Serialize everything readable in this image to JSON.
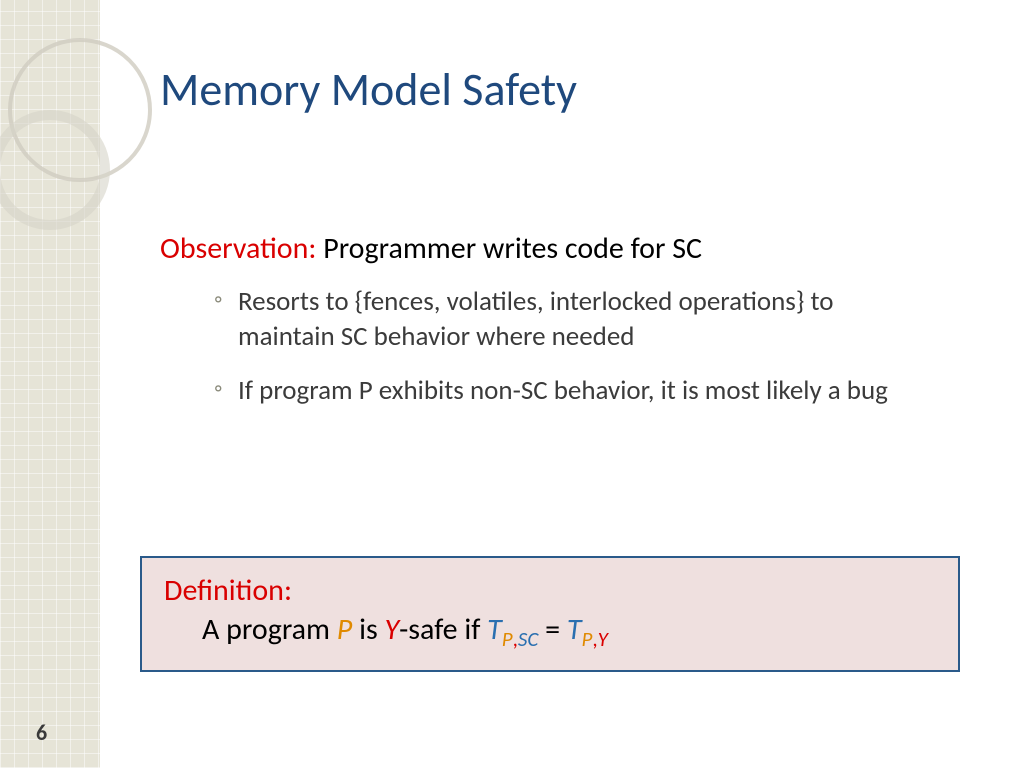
{
  "title": "Memory Model Safety",
  "observation": {
    "label": "Observation:",
    "text": "Programmer writes code for SC"
  },
  "bullets": [
    "Resorts to {fences, volatiles, interlocked operations} to maintain SC behavior where needed",
    "If program P exhibits non-SC behavior, it is most likely a bug"
  ],
  "definition": {
    "label": "Definition:",
    "text_prefix": "A program ",
    "P": "P",
    "text_is": " is ",
    "Y": "Y",
    "text_safe": "-safe if ",
    "T1": "T",
    "sub1_a": "P",
    "sub1_comma": ",",
    "sub1_b": "SC",
    "eq": " = ",
    "T2": "T",
    "sub2_a": "P",
    "sub2_comma": ",",
    "sub2_b": "Y"
  },
  "page": "6"
}
